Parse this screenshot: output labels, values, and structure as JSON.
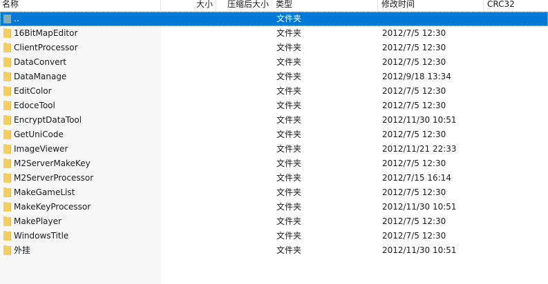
{
  "columns": {
    "name": "名称",
    "size": "大小",
    "packed_size": "压缩后大小",
    "type": "类型",
    "modified": "修改时间",
    "crc": "CRC32"
  },
  "rows": [
    {
      "name": "..",
      "type": "文件夹",
      "modified": "",
      "icon": "parent-folder-icon",
      "selected": true
    },
    {
      "name": "16BitMapEditor",
      "type": "文件夹",
      "modified": "2012/7/5 12:30",
      "icon": "folder-icon"
    },
    {
      "name": "ClientProcessor",
      "type": "文件夹",
      "modified": "2012/7/5 12:30",
      "icon": "folder-icon"
    },
    {
      "name": "DataConvert",
      "type": "文件夹",
      "modified": "2012/7/5 12:30",
      "icon": "folder-icon"
    },
    {
      "name": "DataManage",
      "type": "文件夹",
      "modified": "2012/9/18 13:34",
      "icon": "folder-icon"
    },
    {
      "name": "EditColor",
      "type": "文件夹",
      "modified": "2012/7/5 12:30",
      "icon": "folder-icon"
    },
    {
      "name": "EdoceTool",
      "type": "文件夹",
      "modified": "2012/7/5 12:30",
      "icon": "folder-icon"
    },
    {
      "name": "EncryptDataTool",
      "type": "文件夹",
      "modified": "2012/11/30 10:51",
      "icon": "folder-icon"
    },
    {
      "name": "GetUniCode",
      "type": "文件夹",
      "modified": "2012/7/5 12:30",
      "icon": "folder-icon"
    },
    {
      "name": "ImageViewer",
      "type": "文件夹",
      "modified": "2012/11/21 22:33",
      "icon": "folder-icon"
    },
    {
      "name": "M2ServerMakeKey",
      "type": "文件夹",
      "modified": "2012/7/5 12:30",
      "icon": "folder-icon"
    },
    {
      "name": "M2ServerProcessor",
      "type": "文件夹",
      "modified": "2012/7/15 16:14",
      "icon": "folder-icon"
    },
    {
      "name": "MakeGameList",
      "type": "文件夹",
      "modified": "2012/7/5 12:30",
      "icon": "folder-icon"
    },
    {
      "name": "MakeKeyProcessor",
      "type": "文件夹",
      "modified": "2012/11/30 10:51",
      "icon": "folder-icon"
    },
    {
      "name": "MakePlayer",
      "type": "文件夹",
      "modified": "2012/7/5 12:30",
      "icon": "folder-icon"
    },
    {
      "name": "WindowsTitle",
      "type": "文件夹",
      "modified": "2012/7/5 12:30",
      "icon": "folder-icon"
    },
    {
      "name": "外挂",
      "type": "文件夹",
      "modified": "2012/11/30 10:51",
      "icon": "folder-icon"
    }
  ],
  "colors": {
    "selection": "#0078d7",
    "folder": "#f6cf5a",
    "name_column_background": "#f7f7f7"
  }
}
